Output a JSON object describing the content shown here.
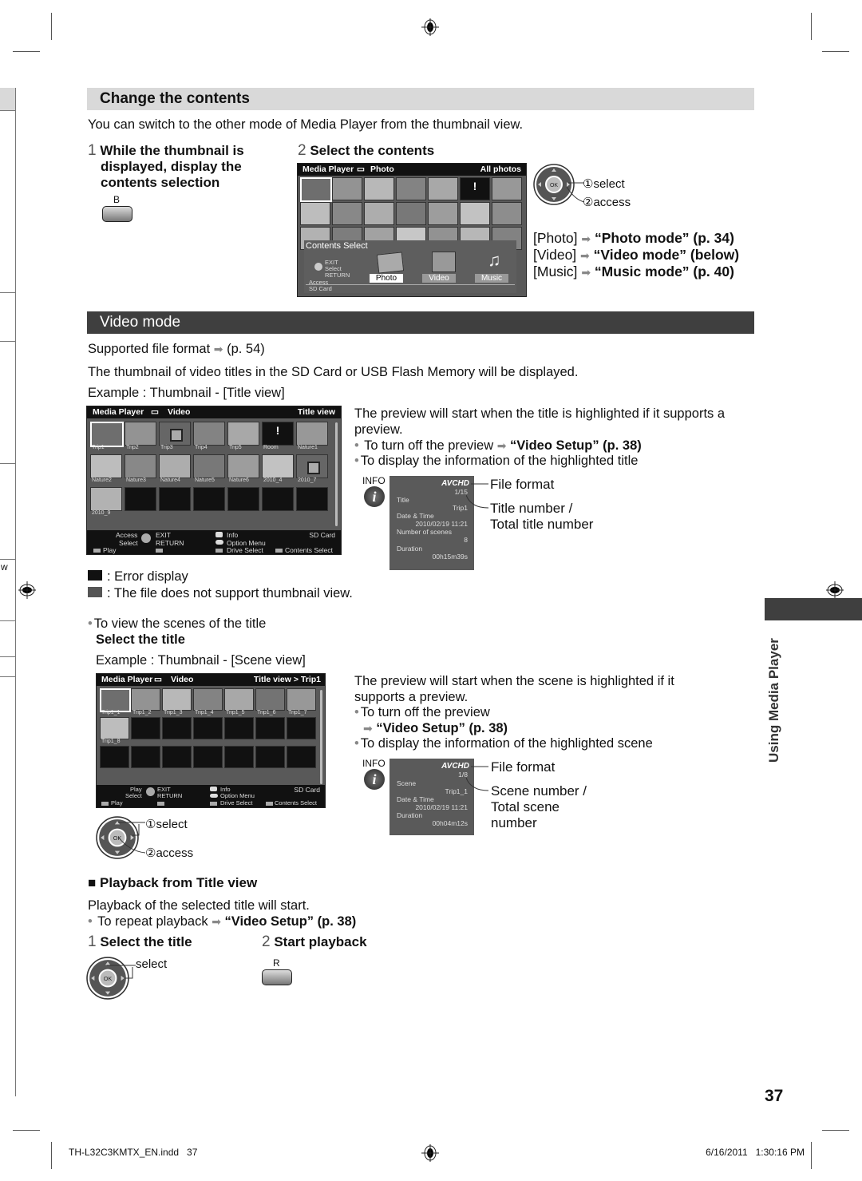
{
  "page": {
    "number": "37",
    "side_tab": "Using Media Player",
    "footer_file": "TH-L32C3KMTX_EN.indd   37",
    "footer_date": "6/16/2011   1:30:16 PM",
    "margin_letter": "w"
  },
  "change_contents": {
    "heading": "Change the contents",
    "intro": "You can switch to the other mode of Media Player from the thumbnail view.",
    "step1": {
      "num": "1",
      "text_l1": "While the thumbnail is",
      "text_l2": "displayed, display the",
      "text_l3": "contents selection",
      "button": "B"
    },
    "step2": {
      "num": "2",
      "text": "Select the contents"
    },
    "screen": {
      "header_left": "Media Player",
      "header_mode": "Photo",
      "header_right": "All photos",
      "overlay_title": "Contents Select",
      "nav_exit": "EXIT",
      "nav_select": "Select",
      "nav_return": "RETURN",
      "nav_access": "Access",
      "drive": "SD Card",
      "options": [
        "Photo",
        "Video",
        "Music"
      ],
      "selected_option": "Photo"
    },
    "dpad": {
      "ok": "OK",
      "select": "①select",
      "access": "②access"
    },
    "links": [
      {
        "label": "[Photo]",
        "target": "“Photo mode” (p. 34)"
      },
      {
        "label": "[Video]",
        "target": "“Video mode” (below)"
      },
      {
        "label": "[Music]",
        "target": "“Music mode” (p. 40)"
      }
    ]
  },
  "video_mode": {
    "heading": "Video mode",
    "supported": "Supported file format",
    "supported_ref": "(p. 54)",
    "desc": "The thumbnail of video titles in the SD Card or USB Flash Memory will be displayed.",
    "example_title": "Example : Thumbnail - [Title view]",
    "title_screen": {
      "header_left": "Media Player",
      "header_mode": "Video",
      "header_right": "Title view",
      "labels": [
        "Trip1",
        "Trip2",
        "Trip3",
        "Trip4",
        "Trip5",
        "Room",
        "Nature1",
        "Nature2",
        "Nature3",
        "Nature4",
        "Nature5",
        "Nature6",
        "2010_4",
        "2010_7",
        "2010_9"
      ],
      "foot": {
        "access": "Access",
        "select": "Select",
        "exit": "EXIT",
        "return": "RETURN",
        "info": "Info",
        "option": "Option Menu",
        "drive": "SD Card",
        "play": "Play",
        "drive_select": "Drive Select",
        "contents_select": "Contents Select"
      }
    },
    "preview_text": "The preview will start when the title is highlighted if it supports a preview.",
    "bullet_off": "To turn off the preview",
    "bullet_off_ref": "“Video Setup” (p. 38)",
    "bullet_info": "To display the information of the highlighted title",
    "info_panel": {
      "info_label": "INFO",
      "format": "AVCHD",
      "count": "1/15",
      "title_label": "Title",
      "title_value": "Trip1",
      "date_label": "Date & Time",
      "date_value": "2010/02/19 11:21",
      "scenes_label": "Number of scenes",
      "scenes_value": "8",
      "duration_label": "Duration",
      "duration_value": "00h15m39s",
      "callout_format": "File format",
      "callout_number_l1": "Title number /",
      "callout_number_l2": "Total title number"
    },
    "legend_error": ": Error display",
    "legend_nothumb": ": The file does not support thumbnail view.",
    "bullet_scenes": "To view the scenes of the title",
    "select_title": "Select the title",
    "example_scene": "Example : Thumbnail - [Scene view]",
    "scene_screen": {
      "header_left": "Media Player",
      "header_mode": "Video",
      "header_right": "Title view  >  Trip1",
      "labels": [
        "Trip1_1",
        "Trip1_2",
        "Trip1_3",
        "Trip1_4",
        "Trip1_5",
        "Trip1_6",
        "Trip1_7",
        "Trip1_8"
      ],
      "foot": {
        "play_top": "Play",
        "select": "Select",
        "exit": "EXIT",
        "return": "RETURN",
        "info": "Info",
        "option": "Option Menu",
        "drive": "SD Card",
        "play": "Play",
        "drive_select": "Drive Select",
        "contents_select": "Contents Select"
      }
    },
    "scene_preview_text_l1": "The preview will start when the scene is highlighted if it",
    "scene_preview_text_l2": "supports a preview.",
    "scene_bullet_off": "To turn off the preview",
    "scene_bullet_off_ref": "“Video Setup” (p. 38)",
    "scene_bullet_info": "To display the information of the highlighted scene",
    "scene_info_panel": {
      "info_label": "INFO",
      "format": "AVCHD",
      "count": "1/8",
      "scene_label": "Scene",
      "scene_value": "Trip1_1",
      "date_label": "Date & Time",
      "date_value": "2010/02/19 11:21",
      "duration_label": "Duration",
      "duration_value": "00h04m12s",
      "callout_format": "File format",
      "callout_number_l1": "Scene number /",
      "callout_number_l2": "Total scene",
      "callout_number_l3": "number"
    },
    "scene_dpad": {
      "ok": "OK",
      "select": "①select",
      "access": "②access"
    }
  },
  "playback": {
    "heading": "Playback from Title view",
    "desc": "Playback of the selected title will start.",
    "bullet_repeat": "To repeat playback",
    "bullet_repeat_ref": "“Video Setup” (p. 38)",
    "step1": {
      "num": "1",
      "text": "Select the title",
      "dpad_ok": "OK",
      "dpad_label": "select"
    },
    "step2": {
      "num": "2",
      "text": "Start playback",
      "button": "R"
    }
  }
}
